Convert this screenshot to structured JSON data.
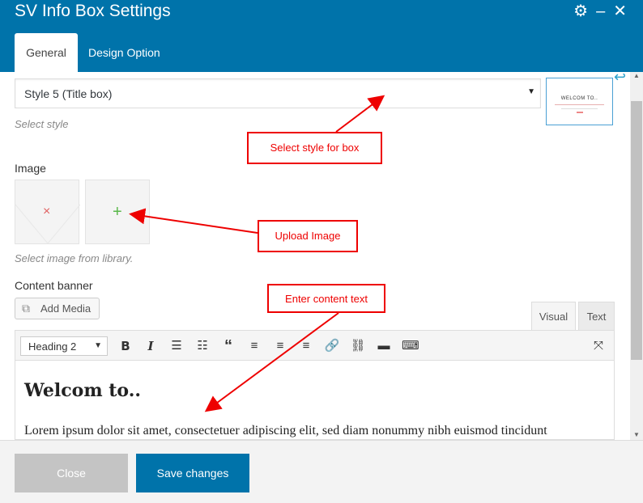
{
  "window": {
    "title": "SV Info Box Settings",
    "icons": [
      "gear-icon",
      "minimize-icon",
      "close-icon"
    ]
  },
  "tabs": [
    {
      "label": "General",
      "active": true
    },
    {
      "label": "Design Option",
      "active": false
    }
  ],
  "style_field": {
    "selected": "Style 5 (Title box)",
    "help": "Select style",
    "preview_text": "WELCOM TO.."
  },
  "image_field": {
    "label": "Image",
    "help": "Select image from library."
  },
  "content_field": {
    "label": "Content banner",
    "add_media": "Add Media",
    "editor_tabs": [
      "Visual",
      "Text"
    ],
    "format": "Heading 2",
    "heading": "Welcom to..",
    "paragraph": "Lorem ipsum dolor sit amet, consectetuer adipiscing elit, sed diam nonummy nibh euismod tincidunt"
  },
  "annotations": {
    "style": "Select style for box",
    "upload": "Upload Image",
    "content": "Enter content text"
  },
  "footer": {
    "close": "Close",
    "save": "Save changes"
  },
  "colors": {
    "header": "#0073aa",
    "annotation": "#e00000",
    "save_button": "#0073aa"
  }
}
